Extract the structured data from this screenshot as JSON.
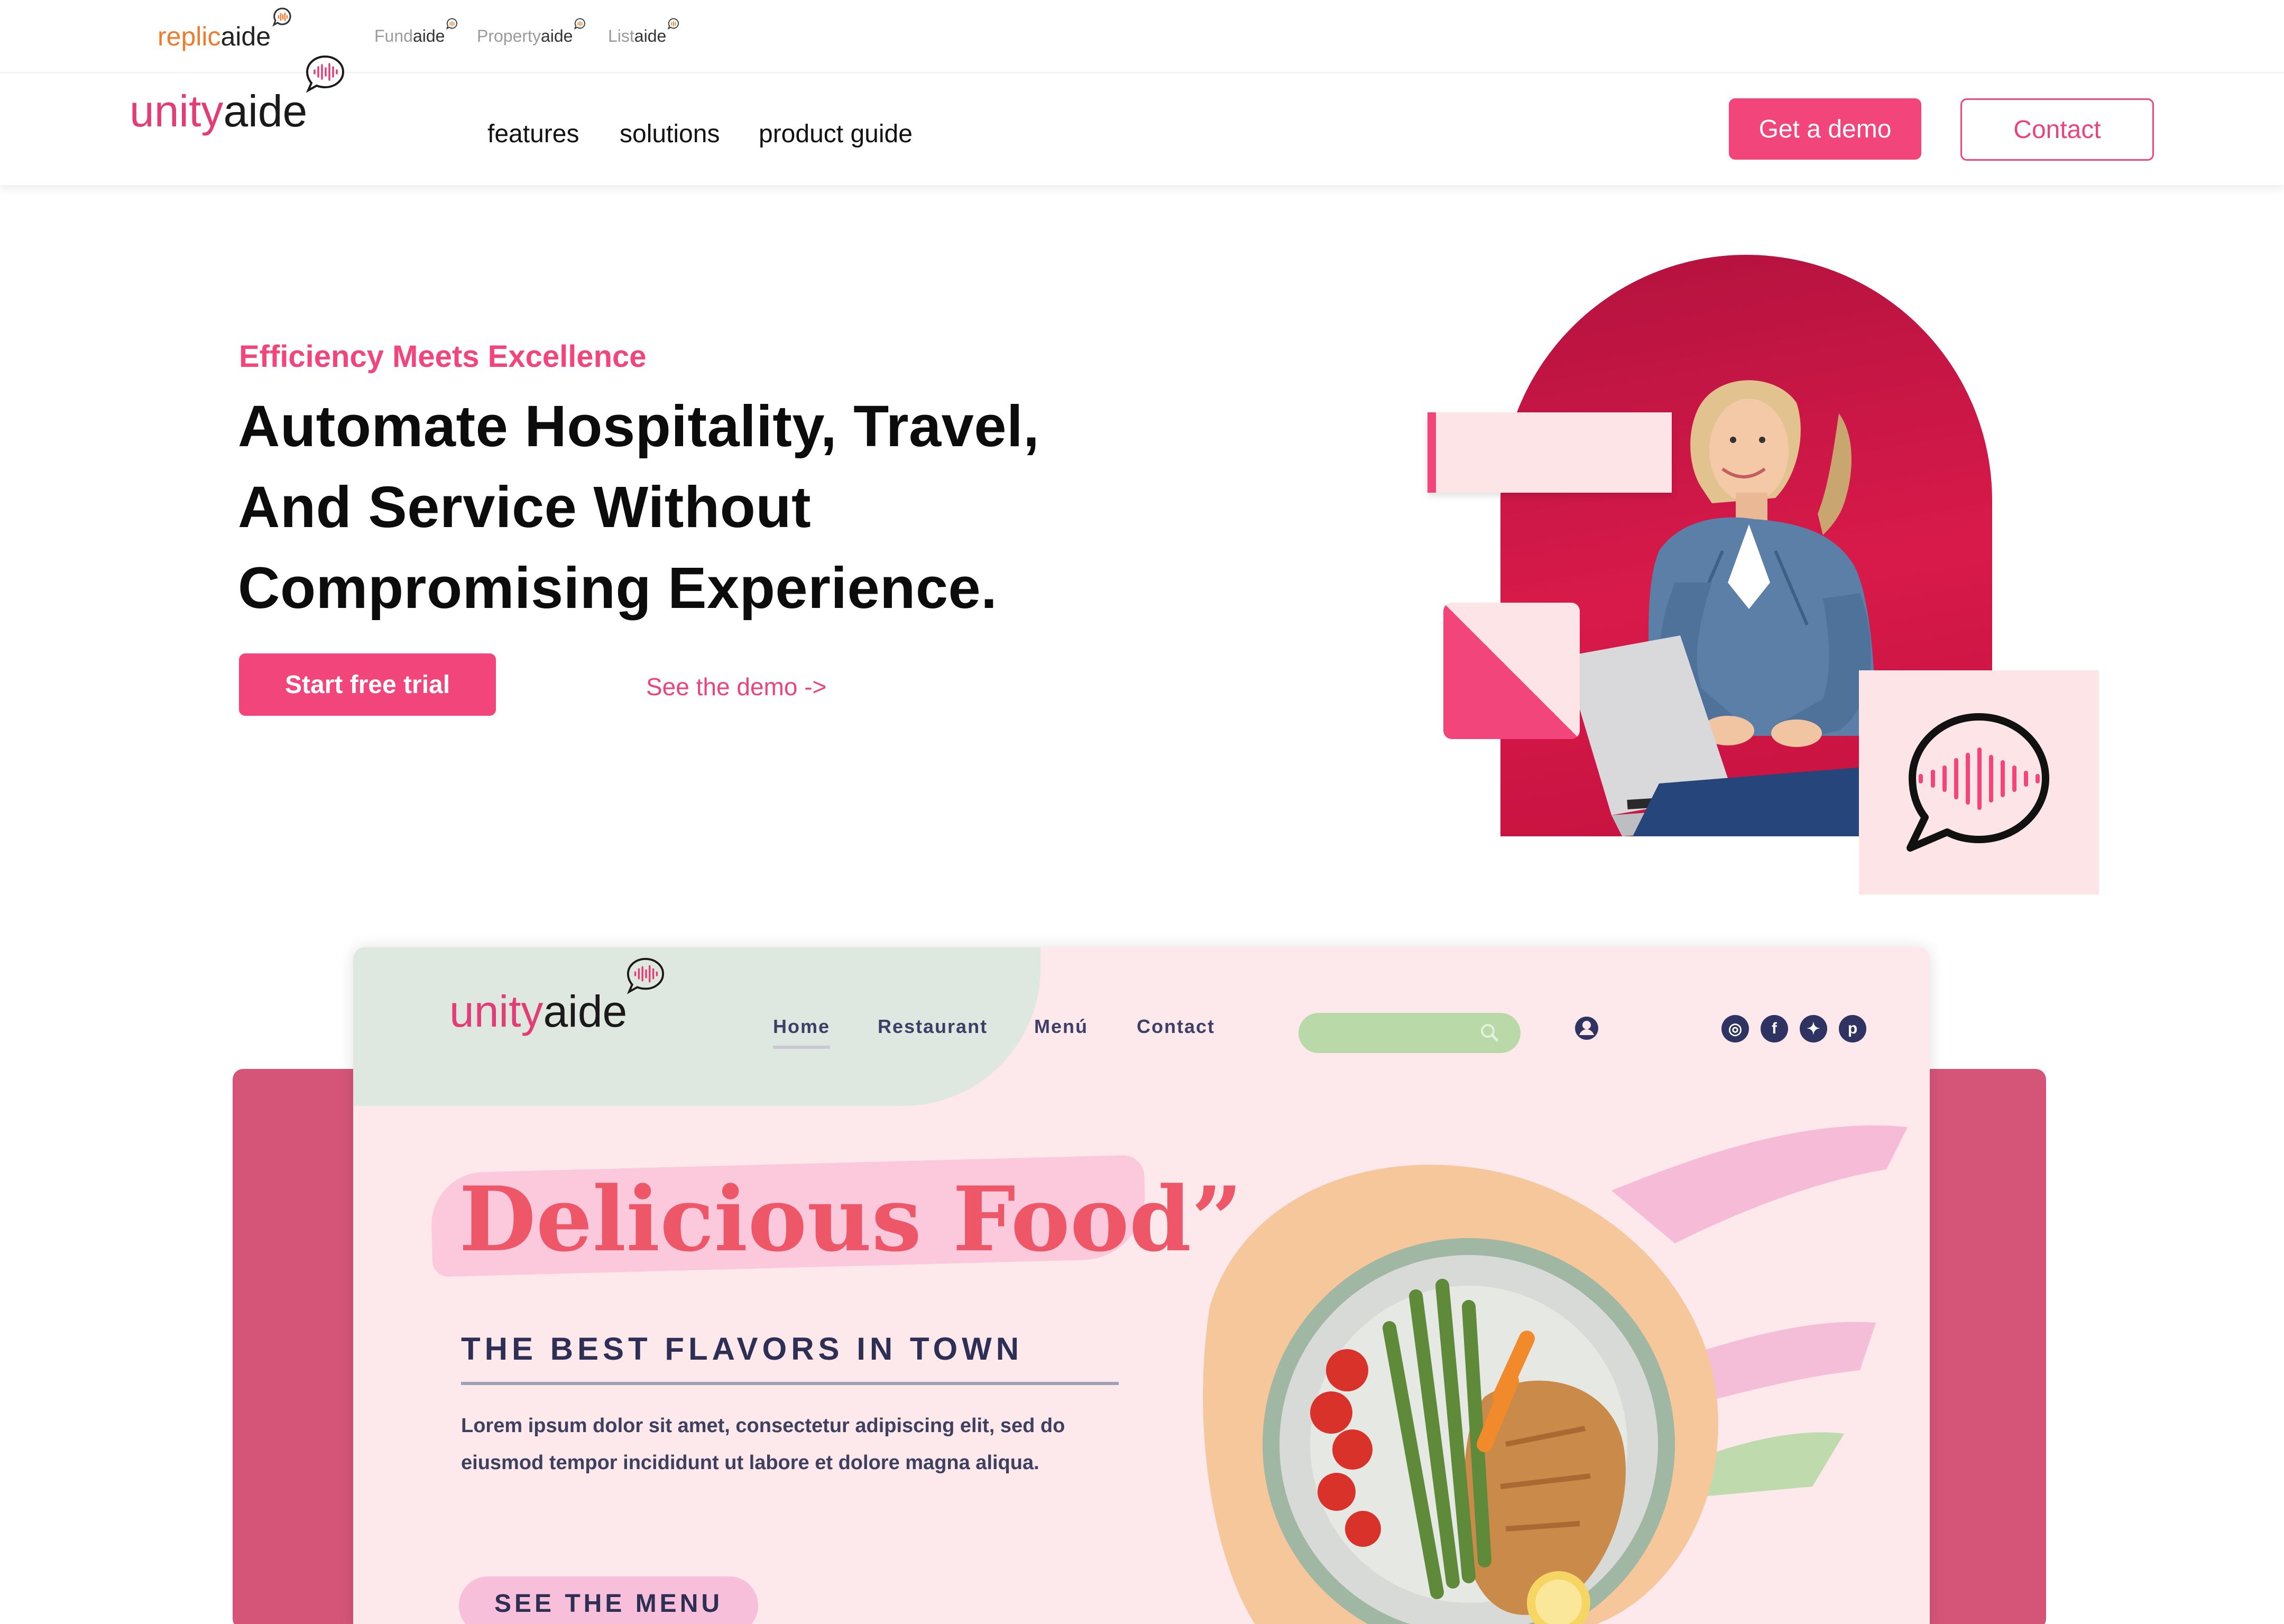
{
  "brand_strip": {
    "replicaide": {
      "part1": "replic",
      "part2": "aide"
    },
    "fundaide": {
      "part1": "Fund",
      "part2": "aide"
    },
    "propertyaide": {
      "part1": "Property",
      "part2": "aide"
    },
    "listaide": {
      "part1": "List",
      "part2": "aide"
    }
  },
  "nav": {
    "logo": {
      "part1": "unity",
      "part2": "aide"
    },
    "links": [
      "features",
      "solutions",
      "product guide"
    ],
    "demo_button": "Get a demo",
    "contact_button": "Contact"
  },
  "hero": {
    "eyebrow": "Efficiency Meets Excellence",
    "headline_lines": [
      "Automate Hospitality, Travel,",
      "And Service Without",
      "Compromising Experience."
    ],
    "primary_button": "Start free trial",
    "secondary_link": "See the demo ->"
  },
  "showcase": {
    "logo": {
      "part1": "unity",
      "part2": "aide"
    },
    "nav": [
      "Home",
      "Restaurant",
      "Menú",
      "Contact"
    ],
    "title": "Delicious Food”",
    "subtitle": "THE BEST FLAVORS IN TOWN",
    "body": "Lorem ipsum dolor sit amet, consectetur adipiscing elit, sed do eiusmod tempor incididunt ut labore et dolore magna aliqua.",
    "cta": "SEE THE MENU",
    "socials": [
      "instagram-icon",
      "facebook-icon",
      "twitter-icon",
      "pinterest-icon"
    ]
  },
  "colors": {
    "accent": "#f2457b",
    "arch": "#c4113f",
    "soft_pink": "#fde4e6",
    "panel": "#d55578",
    "replic_orange": "#f07b2b"
  }
}
